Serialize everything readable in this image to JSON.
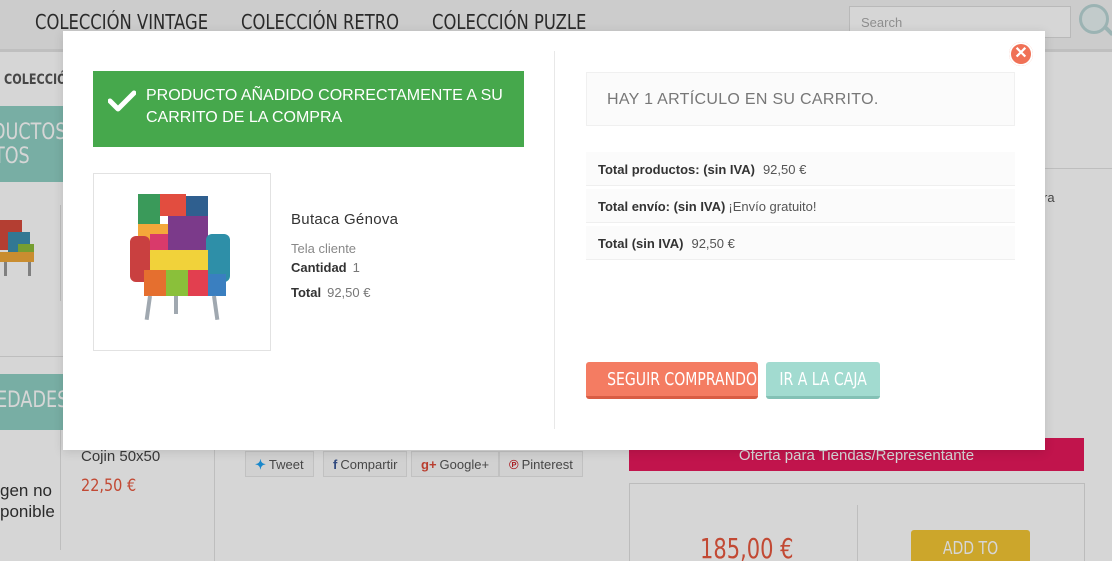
{
  "nav": {
    "items": [
      "COLECCIÓN VINTAGE",
      "COLECCIÓN RETRO",
      "COLECCIÓN PUZLE"
    ],
    "search_placeholder": "Search"
  },
  "background": {
    "breadcrumb": "COLECCIÓ",
    "band1_line1": "ODUCTOS",
    "band1_line2": "TOS",
    "band2": "EDADES",
    "cojin_name": "Cojin 50x50",
    "cojin_price": "22,50 €",
    "no_image_line1": "gen no",
    "no_image_line2": "ponible",
    "share": {
      "tweet": "Tweet",
      "facebook": "Compartir",
      "gplus": "Google+",
      "pinterest": "Pinterest"
    },
    "offer": "Oferta para Tiendas/Representante",
    "big_price": "185,00 €",
    "add_to_cart": "ADD TO CART",
    "side_fragment": "ra"
  },
  "modal": {
    "success_message": "PRODUCTO AÑADIDO CORRECTAMENTE A SU CARRITO DE LA COMPRA",
    "product": {
      "name": "Butaca Génova",
      "attribute": "Tela cliente",
      "quantity_label": "Cantidad",
      "quantity": "1",
      "total_label": "Total",
      "total": "92,50 €"
    },
    "cart_summary": {
      "count_text": "HAY 1 ARTÍCULO EN SU CARRITO.",
      "products_label": "Total productos: (sin IVA)",
      "products_value": "92,50 €",
      "shipping_label": "Total envío:  (sin IVA)",
      "shipping_value": "¡Envío gratuito!",
      "total_label": "Total (sin IVA)",
      "total_value": "92,50 €"
    },
    "continue_button": "SEGUIR COMPRANDO",
    "checkout_button": "IR A LA CAJA",
    "close_icon": "close-icon"
  },
  "colors": {
    "success": "#46a84c",
    "continue": "#f47c62",
    "checkout": "#a2dbd0",
    "offer": "#e6195b",
    "price": "#e8583e",
    "add_to_cart": "#f4c634"
  }
}
